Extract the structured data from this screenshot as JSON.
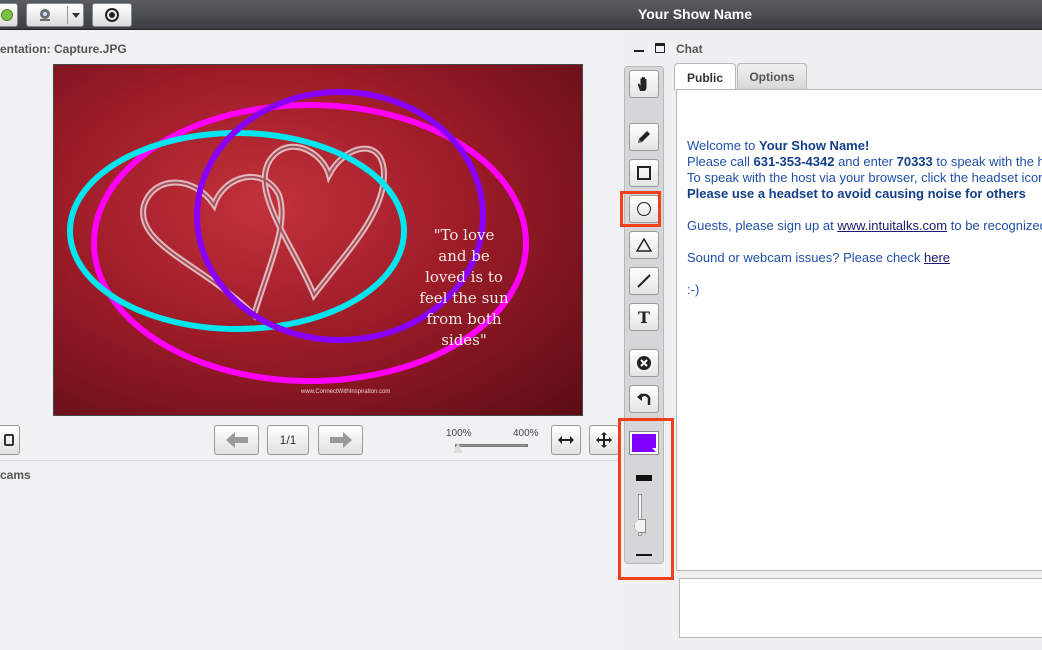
{
  "header": {
    "title": "Your Show Name"
  },
  "presentation": {
    "label": "entation: Capture.JPG",
    "slide": {
      "quote_lines": [
        "\"To love",
        "and be",
        "loved is to",
        "feel the sun",
        "from both",
        "sides\""
      ],
      "url": "www.ConnectWithInspiration.com",
      "annotations": [
        {
          "shape": "ellipse",
          "color": "#ff00ff"
        },
        {
          "shape": "ellipse",
          "color": "#00e5ee"
        },
        {
          "shape": "ellipse",
          "color": "#8a00ff"
        }
      ]
    },
    "navigation": {
      "page_label": "1/1",
      "zoom_min_label": "100%",
      "zoom_max_label": "400%"
    },
    "cams_label": "cams"
  },
  "toolbar": {
    "tools": [
      "hand-icon",
      "pencil-icon",
      "rectangle-icon",
      "ellipse-icon",
      "triangle-icon",
      "line-icon",
      "text-icon",
      "clear-icon",
      "undo-icon"
    ],
    "text_tool_glyph": "T",
    "selected_tool": "ellipse-icon",
    "selected_color": "#8000ff",
    "highlight_color": "#f2401c"
  },
  "chat": {
    "title": "Chat",
    "tabs": [
      {
        "label": "Public",
        "active": true
      },
      {
        "label": "Options",
        "active": false
      }
    ],
    "messages": {
      "welcome_prefix": "Welcome to ",
      "welcome_name": "Your Show Name!",
      "call_prefix": " Please call ",
      "phone": "631-353-4342",
      "call_middle": " and enter ",
      "pin": "70333",
      "call_suffix": " to speak with the host",
      "browser_line": "To speak with the host via your browser, click the headset icon",
      "headset_line": "Please use a headset to avoid causing noise for others",
      "guests_prefix": "Guests, please sign up at ",
      "guests_link": "www.intuitalks.com",
      "guests_suffix": " to be recognized",
      "issues_prefix": "Sound or webcam issues? Please check ",
      "issues_link": "here",
      "smiley": ":-)"
    }
  }
}
